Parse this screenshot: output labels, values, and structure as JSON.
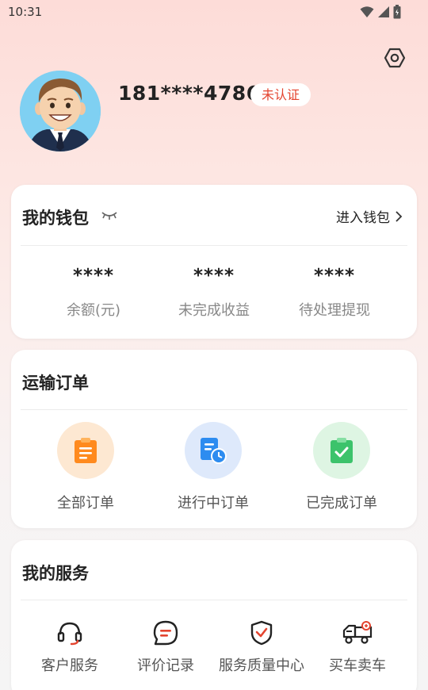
{
  "status_bar": {
    "time": "10:31"
  },
  "profile": {
    "phone": "181****4786",
    "verify_badge": "未认证",
    "colors": {
      "badge_text": "#e4442f"
    }
  },
  "wallet": {
    "title": "我的钱包",
    "enter_label": "进入钱包",
    "stats": [
      {
        "value": "****",
        "label": "余额(元)"
      },
      {
        "value": "****",
        "label": "未完成收益"
      },
      {
        "value": "****",
        "label": "待处理提现"
      }
    ]
  },
  "orders": {
    "title": "运输订单",
    "items": [
      {
        "label": "全部订单",
        "icon": "clipboard-icon",
        "color": "#ff8a1e",
        "bg": "#fde8d2"
      },
      {
        "label": "进行中订单",
        "icon": "document-clock-icon",
        "color": "#2d8cf0",
        "bg": "#dee9fb"
      },
      {
        "label": "已完成订单",
        "icon": "clipboard-check-icon",
        "color": "#3cc36b",
        "bg": "#def5e3"
      }
    ]
  },
  "services": {
    "title": "我的服务",
    "items": [
      {
        "label": "客户服务",
        "icon": "headset-icon"
      },
      {
        "label": "评价记录",
        "icon": "chat-bubble-icon"
      },
      {
        "label": "服务质量中心",
        "icon": "shield-check-icon"
      },
      {
        "label": "买车卖车",
        "icon": "truck-icon"
      }
    ]
  }
}
